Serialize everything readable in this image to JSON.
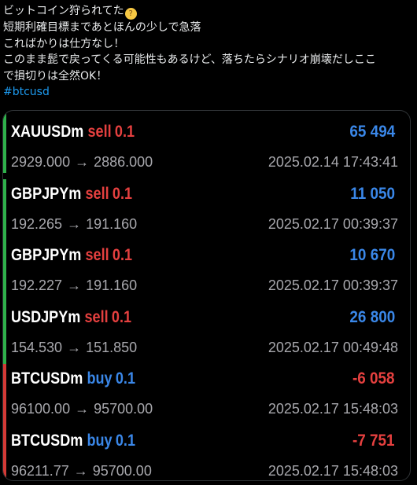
{
  "post": {
    "lines": [
      "ビットコイン狩られてた",
      "短期利確目標まであとほんの少しで急落",
      "こればかりは仕方なし！",
      "このまま髭で戻ってくる可能性もあるけど、落ちたらシナリオ崩壊だしここ",
      "で損切りは全然OK！"
    ],
    "emoji": "thinking-face",
    "hashtag": "#btcusd"
  },
  "colors": {
    "sell": "#e5403f",
    "buy": "#3a87e8",
    "profit": "#3a87e8",
    "loss": "#e5403f",
    "accent_profit": "#2fb04a",
    "accent_loss": "#d33a36"
  },
  "trades": [
    {
      "symbol": "XAUUSDm",
      "side": "sell",
      "lot": "0.1",
      "profit": "65 494",
      "open": "2929.000",
      "close": "2886.000",
      "time": "2025.02.14 17:43:41"
    },
    {
      "symbol": "GBPJPYm",
      "side": "sell",
      "lot": "0.1",
      "profit": "11 050",
      "open": "192.265",
      "close": "191.160",
      "time": "2025.02.17 00:39:37"
    },
    {
      "symbol": "GBPJPYm",
      "side": "sell",
      "lot": "0.1",
      "profit": "10 670",
      "open": "192.227",
      "close": "191.160",
      "time": "2025.02.17 00:39:37"
    },
    {
      "symbol": "USDJPYm",
      "side": "sell",
      "lot": "0.1",
      "profit": "26 800",
      "open": "154.530",
      "close": "151.850",
      "time": "2025.02.17 00:49:48"
    },
    {
      "symbol": "BTCUSDm",
      "side": "buy",
      "lot": "0.1",
      "profit": "-6 058",
      "open": "96100.00",
      "close": "95700.00",
      "time": "2025.02.17 15:48:03"
    },
    {
      "symbol": "BTCUSDm",
      "side": "buy",
      "lot": "0.1",
      "profit": "-7 751",
      "open": "96211.77",
      "close": "95700.00",
      "time": "2025.02.17 15:48:03"
    }
  ],
  "arrow": "→"
}
